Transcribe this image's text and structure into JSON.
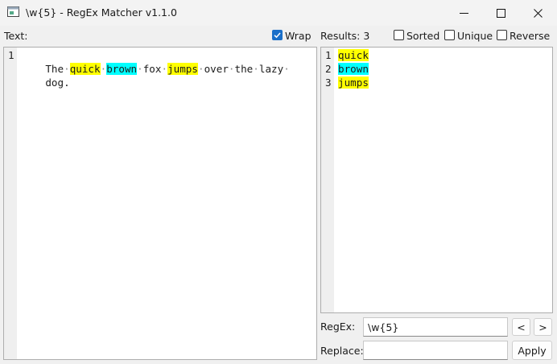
{
  "window": {
    "title": "\\w{5} - RegEx Matcher v1.1.0",
    "controls": {
      "minimize_icon": "minimize-icon",
      "maximize_icon": "maximize-icon",
      "close_icon": "close-icon"
    }
  },
  "text_panel": {
    "label": "Text:",
    "wrap": {
      "label": "Wrap",
      "checked": true
    },
    "line_numbers": [
      "1"
    ],
    "words": [
      {
        "text": "The",
        "highlight": ""
      },
      {
        "text": "quick",
        "highlight": "yellow"
      },
      {
        "text": "brown",
        "highlight": "cyan"
      },
      {
        "text": "fox",
        "highlight": ""
      },
      {
        "text": "jumps",
        "highlight": "yellow"
      },
      {
        "text": "over",
        "highlight": ""
      },
      {
        "text": "the",
        "highlight": ""
      },
      {
        "text": "lazy",
        "highlight": ""
      },
      {
        "text": "dog.",
        "highlight": ""
      }
    ]
  },
  "results_panel": {
    "label": "Results: 3",
    "options": [
      {
        "label": "Sorted",
        "checked": false
      },
      {
        "label": "Unique",
        "checked": false
      },
      {
        "label": "Reverse",
        "checked": false
      }
    ],
    "results": [
      {
        "num": "1",
        "text": "quick",
        "highlight": "yellow"
      },
      {
        "num": "2",
        "text": "brown",
        "highlight": "cyan"
      },
      {
        "num": "3",
        "text": "jumps",
        "highlight": "yellow"
      }
    ]
  },
  "controls": {
    "regex_label": "RegEx:",
    "regex_value": "\\w{5}",
    "replace_label": "Replace:",
    "replace_value": "",
    "prev_label": "<",
    "next_label": ">",
    "apply_label": "Apply"
  },
  "colors": {
    "highlight_yellow": "#ffff00",
    "highlight_cyan": "#00ffff",
    "checkbox_accent": "#1a6fc9"
  }
}
